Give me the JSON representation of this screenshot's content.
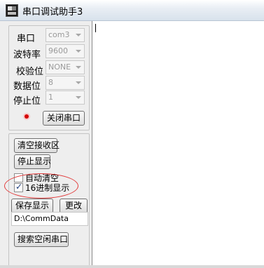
{
  "window": {
    "title": "串口调试助手3"
  },
  "settings": {
    "port_label": "串口",
    "port_value": "com3",
    "baud_label": "波特率",
    "baud_value": "9600",
    "parity_label": "校验位",
    "parity_value": "NONE",
    "databits_label": "数据位",
    "databits_value": "8",
    "stopbits_label": "停止位",
    "stopbits_value": "1",
    "close_port_label": "关闭串口",
    "port_status": "open",
    "led_color": "#d40000"
  },
  "receive": {
    "clear_label": "清空接收区",
    "stop_display_label": "停止显示",
    "auto_clear_label": "自动清空",
    "auto_clear_checked": false,
    "hex_display_label": "16进制显示",
    "hex_display_checked": true,
    "save_display_label": "保存显示",
    "change_label": "更改",
    "save_path": "D:\\CommData",
    "search_port_label": "搜索空闲串口"
  },
  "colors": {
    "highlight_ellipse": "#e23b3b"
  }
}
